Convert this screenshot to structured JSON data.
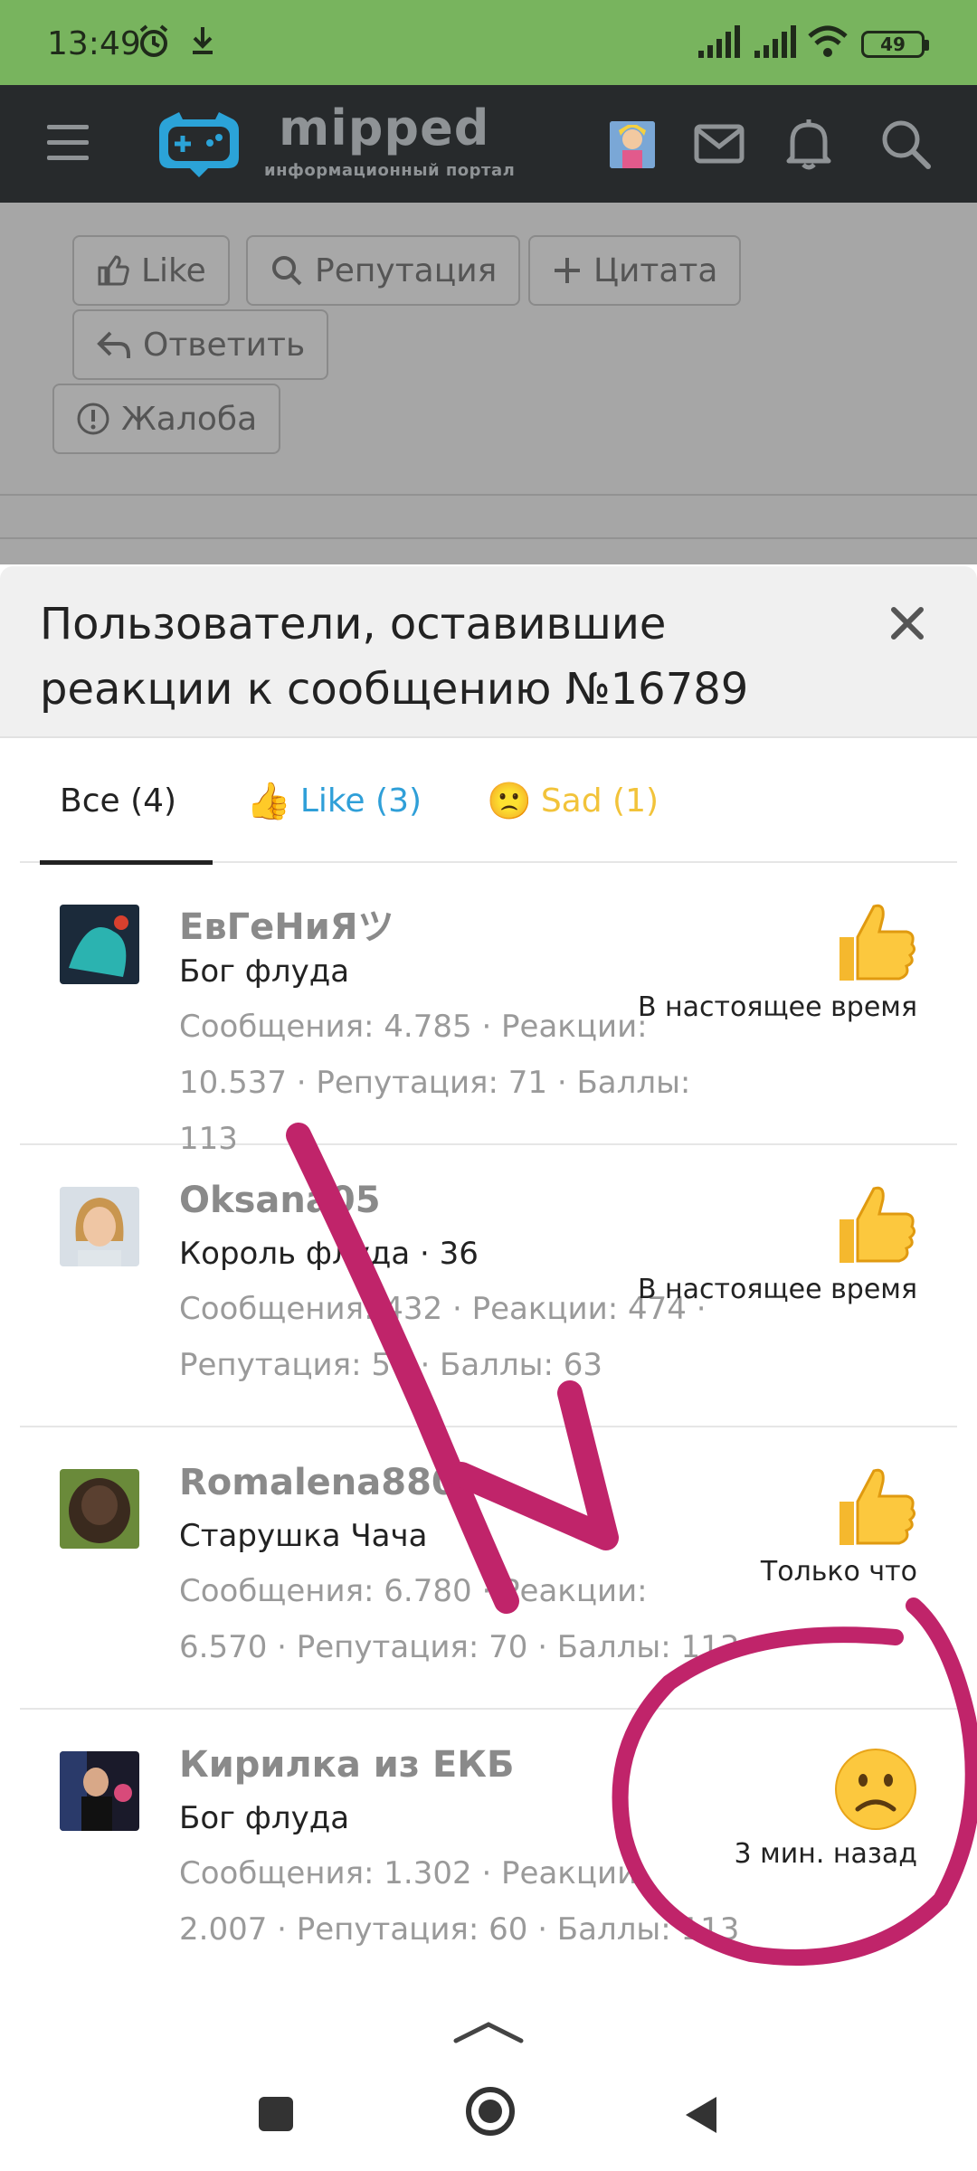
{
  "status_bar": {
    "time": "13:49",
    "battery": "49",
    "icons": [
      "alarm-icon",
      "download-icon",
      "signal-icon",
      "signal-icon",
      "wifi-icon",
      "battery-icon"
    ]
  },
  "header": {
    "logo_text": "mipped",
    "logo_sub": "информационный портал",
    "icons": [
      "menu-icon",
      "mail-icon",
      "bell-icon",
      "search-icon"
    ]
  },
  "background_buttons": {
    "like": "Like",
    "reputation": "Репутация",
    "quote": "Цитата",
    "reply": "Ответить",
    "report": "Жалоба"
  },
  "modal": {
    "title_line1": "Пользователи, оставившие",
    "title_line2": "реакции к сообщению №16789",
    "tabs": [
      {
        "label": "Все (4)",
        "color": "#222222",
        "emoji": ""
      },
      {
        "label": "Like (3)",
        "color": "#2f9fd8",
        "emoji": "👍"
      },
      {
        "label": "Sad (1)",
        "color": "#f2c33a",
        "emoji": "🙁"
      }
    ],
    "users": [
      {
        "name": "ЕвГеНиЯツ",
        "rank": "Бог флуда",
        "stats": "Сообщения: 4.785 · Реакции: 10.537 · Репутация: 71 · Баллы: 113",
        "reaction": "👍",
        "when": "В настоящее время"
      },
      {
        "name": "Oksana05",
        "rank": "Король флуда · 36",
        "stats": "Сообщения: 432 · Реакции: 474 · Репутация: 57 · Баллы: 63",
        "reaction": "👍",
        "when": "В настоящее время"
      },
      {
        "name": "Romalena880",
        "rank": "Старушка Чача",
        "stats": "Сообщения: 6.780 · Реакции: 6.570 · Репутация: 70 · Баллы: 113",
        "reaction": "👍",
        "when": "Только что"
      },
      {
        "name": "Кирилка из ЕКБ",
        "rank": "Бог флуда",
        "stats": "Сообщения: 1.302 · Реакции: 2.007 · Репутация: 60 · Баллы: 113",
        "reaction": "🙁",
        "when": "3 мин. назад"
      }
    ]
  },
  "colors": {
    "status_bar": "#78b45e",
    "header": "#272a2c",
    "annotation": "#c0246a",
    "like_blue": "#2f9fd8",
    "sad_yellow": "#f2c33a"
  }
}
